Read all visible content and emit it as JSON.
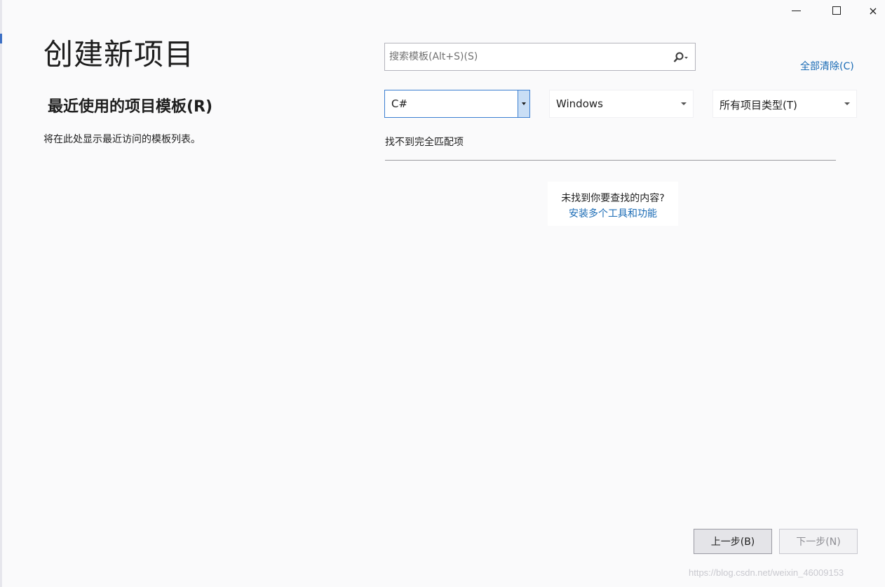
{
  "window": {
    "controls": {
      "minimize": "minimize",
      "maximize": "maximize",
      "close": "×"
    }
  },
  "page": {
    "title": "创建新项目"
  },
  "recent": {
    "heading": "最近使用的项目模板(R)",
    "description": "将在此处显示最近访问的模板列表。"
  },
  "search": {
    "placeholder": "搜索模板(Alt+S)(S)",
    "value": ""
  },
  "filters": {
    "clear_all": "全部清除(C)",
    "language": "C#",
    "platform": "Windows",
    "project_type": "所有项目类型(T)"
  },
  "results": {
    "no_match": "找不到完全匹配项",
    "hint_text": "未找到你要查找的内容?",
    "hint_link": "安装多个工具和功能"
  },
  "footer": {
    "back_label": "上一步(B)",
    "next_label": "下一步(N)"
  },
  "watermark": "https://blog.csdn.net/weixin_46009153",
  "colors": {
    "accent_link": "#1a6bb5",
    "focus_border": "#3c7fd1",
    "background": "#fafafb"
  }
}
